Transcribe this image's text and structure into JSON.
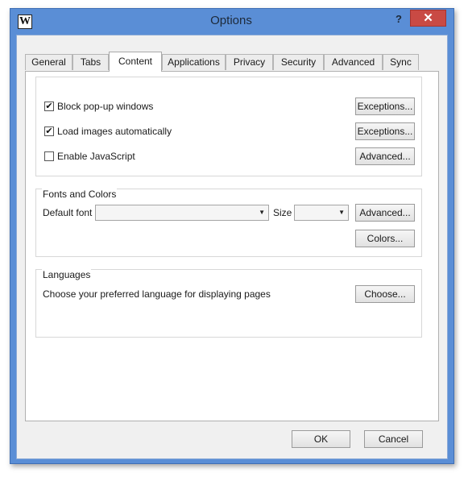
{
  "window": {
    "title": "Options",
    "logo_letter": "W",
    "help": "?",
    "close": "✕"
  },
  "tabs": [
    {
      "label": "General"
    },
    {
      "label": "Tabs"
    },
    {
      "label": "Content",
      "active": true
    },
    {
      "label": "Applications"
    },
    {
      "label": "Privacy"
    },
    {
      "label": "Security"
    },
    {
      "label": "Advanced"
    },
    {
      "label": "Sync"
    }
  ],
  "content": {
    "popups": {
      "label": "Block pop-up windows",
      "checked": true,
      "button": "Exceptions..."
    },
    "images": {
      "label": "Load images automatically",
      "checked": true,
      "button": "Exceptions..."
    },
    "javascript": {
      "label": "Enable JavaScript",
      "checked": false,
      "button": "Advanced..."
    }
  },
  "fonts": {
    "title": "Fonts and Colors",
    "default_font_label": "Default font",
    "default_font_value": "",
    "size_label": "Size",
    "size_value": "",
    "advanced_button": "Advanced...",
    "colors_button": "Colors..."
  },
  "languages": {
    "title": "Languages",
    "description": "Choose your preferred language for displaying pages",
    "choose_button": "Choose..."
  },
  "footer": {
    "ok": "OK",
    "cancel": "Cancel"
  },
  "icons": {
    "check": "check-icon",
    "dropdown": "chevron-down-icon"
  },
  "colors": {
    "title_bar": "#5a8ed6",
    "close_button": "#c94a44"
  }
}
